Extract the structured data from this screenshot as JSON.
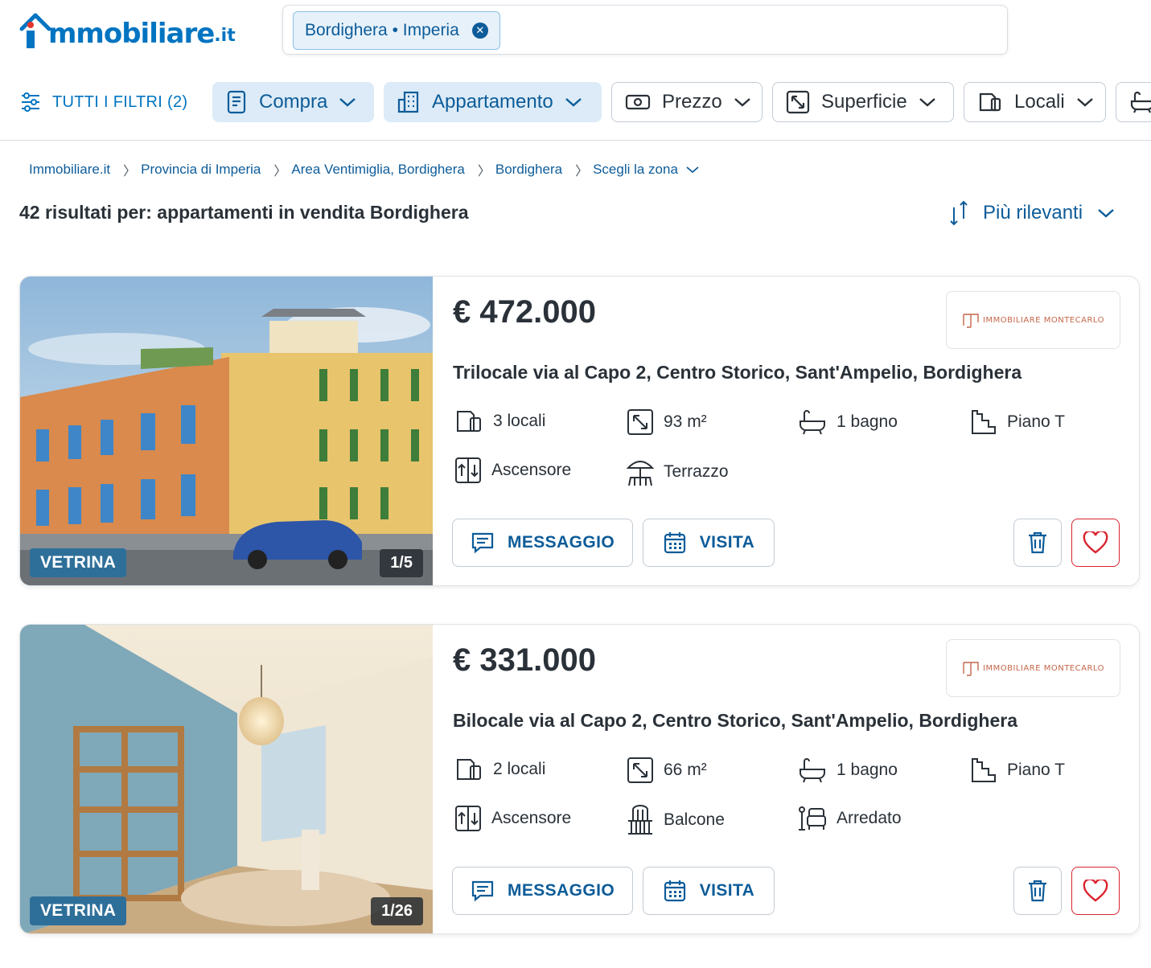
{
  "header": {
    "logo_text": "mmobiliare",
    "logo_tld": ".it",
    "search_chip": "Bordighera • Imperia"
  },
  "filters": {
    "all_filters": "TUTTI I FILTRI (2)",
    "compra": "Compra",
    "appartamento": "Appartamento",
    "prezzo": "Prezzo",
    "superficie": "Superficie",
    "locali": "Locali"
  },
  "breadcrumb": [
    "Immobiliare.it",
    "Provincia di Imperia",
    "Area Ventimiglia, Bordighera",
    "Bordighera",
    "Scegli la zona"
  ],
  "results_title": "42 risultati per: appartamenti in vendita Bordighera",
  "sort_label": "Più rilevanti",
  "listings": [
    {
      "badge": "VETRINA",
      "photo_count": "1/5",
      "price": "€ 472.000",
      "agency": "IMMOBILIARE MONTECARLO",
      "title": "Trilocale via al Capo 2, Centro Storico, Sant'Ampelio, Bordighera",
      "features": {
        "locali": "3 locali",
        "superficie": "93 m²",
        "bagni": "1 bagno",
        "piano": "Piano T",
        "extra1": "Ascensore",
        "extra2": "Terrazzo"
      },
      "message_label": "MESSAGGIO",
      "visit_label": "VISITA"
    },
    {
      "badge": "VETRINA",
      "photo_count": "1/26",
      "price": "€ 331.000",
      "agency": "IMMOBILIARE MONTECARLO",
      "title": "Bilocale via al Capo 2, Centro Storico, Sant'Ampelio, Bordighera",
      "features": {
        "locali": "2 locali",
        "superficie": "66 m²",
        "bagni": "1 bagno",
        "piano": "Piano T",
        "extra1": "Ascensore",
        "extra2": "Balcone",
        "extra3": "Arredato"
      },
      "message_label": "MESSAGGIO",
      "visit_label": "VISITA"
    }
  ],
  "colors": {
    "brand_blue": "#0074c1",
    "link_blue": "#0d5c99",
    "heart_red": "#d9232e",
    "badge_blue": "#2e6f99"
  }
}
